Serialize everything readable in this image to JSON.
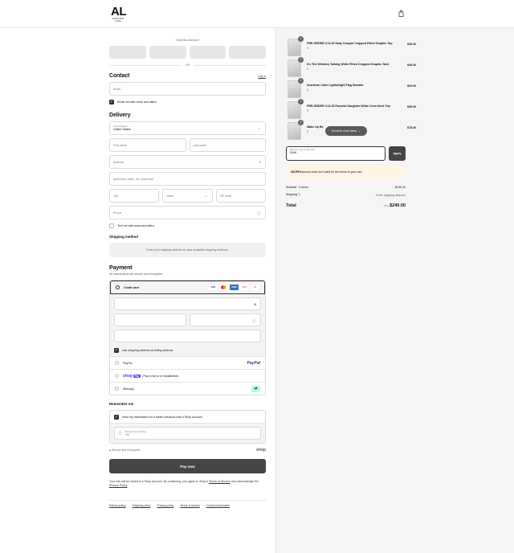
{
  "header": {
    "logo_big": "AL",
    "logo_small": "ANNISTON LANE"
  },
  "express": {
    "label": "Express checkout",
    "or": "OR"
  },
  "contact": {
    "title": "Contact",
    "login": "Log in",
    "email_placeholder": "Email",
    "news": "Email me with news and offers"
  },
  "delivery": {
    "title": "Delivery",
    "country_label": "Country/Region",
    "country": "United States",
    "first": "First name",
    "last": "Last name",
    "address": "Address",
    "apt": "Apartment, suite, etc. (optional)",
    "city": "City",
    "state": "State",
    "zip": "ZIP code",
    "phone": "Phone",
    "text_offers": "Text me with news and offers"
  },
  "shipping": {
    "title": "Shipping method",
    "note": "Enter your shipping address to view available shipping methods."
  },
  "payment": {
    "title": "Payment",
    "sub": "All transactions are secure and encrypted.",
    "credit": "Credit card",
    "cards": [
      "VISA",
      "MC",
      "AMEX",
      "DISC"
    ],
    "more": "+5",
    "billing": "Use shipping address as billing address",
    "paypal": "PayPal",
    "paypal_logo": "PayPal",
    "shop_pay": "shop",
    "shop_pay_badge": "Pay",
    "shop_pay_text": "| Pay in full or in installments",
    "afterpay": "Afterpay"
  },
  "remember": {
    "title": "Remember me",
    "save": "Save my information for a faster checkout with a Shop account",
    "mobile_label": "Mobile phone number",
    "mobile_prefix": "+1",
    "secure": "Secure and encrypted",
    "shop_logo": "shop"
  },
  "pay_button": "Pay now",
  "legal": "Your info will be saved to a Shop account. By continuing, you agree to Shop's",
  "legal_tos": "Terms of Service",
  "legal_and": "and acknowledge the",
  "legal_pp": "Privacy Policy",
  "footer": [
    "Refund policy",
    "Shipping policy",
    "Privacy policy",
    "Terms of service",
    "Contact information"
  ],
  "items": [
    {
      "name": "PRE-ORDER 3.11.25 Salty Cowgirl Cropped Fitted Graphic Top",
      "size": "S",
      "price": "$39.00",
      "qty": "1"
    },
    {
      "name": "It's The Whiskey Talking White Fitted Cropped Graphic Tank",
      "size": "S",
      "price": "$39.00",
      "qty": "1"
    },
    {
      "name": "American Cutie Lightweight Flag Sweater",
      "size": "S",
      "price": "$69.00",
      "qty": "1"
    },
    {
      "name": "PRE-ORDER 3.13.25 Favorite Daughter White Crew Neck Top",
      "size": "S",
      "price": "$35.00",
      "qty": "1"
    },
    {
      "name": "Wake Up Be",
      "size": "S",
      "price": "$78.00",
      "qty": "1"
    }
  ],
  "tooltip": "Scroll for more items",
  "discount": {
    "label": "Discount code or gift card",
    "value": "20off",
    "apply": "Apply",
    "notice_code": "20OFF",
    "notice_text": " discount code isn't valid for the items in your cart"
  },
  "summary": {
    "subtotal_label": "Subtotal · 5 items",
    "subtotal": "$240.00",
    "shipping_label": "Shipping",
    "shipping": "Enter shipping address",
    "total_label": "Total",
    "currency": "USD",
    "total": "$240.00"
  }
}
